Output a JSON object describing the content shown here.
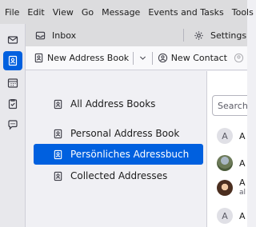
{
  "menubar": {
    "items": [
      "File",
      "Edit",
      "View",
      "Go",
      "Message",
      "Events and Tasks",
      "Tools"
    ]
  },
  "tabs": {
    "inbox": "Inbox",
    "settings": "Settings"
  },
  "toolbar": {
    "new_address_book": "New Address Book",
    "new_contact": "New Contact"
  },
  "books": {
    "items": [
      {
        "label": "All Address Books",
        "selected": false
      },
      {
        "label": "Personal Address Book",
        "selected": false
      },
      {
        "label": "Persönliches Adressbuch",
        "selected": true
      },
      {
        "label": "Collected Addresses",
        "selected": false
      }
    ]
  },
  "contacts": {
    "search_placeholder": "Search",
    "items": [
      {
        "initial": "A",
        "name": "A",
        "sub": ""
      },
      {
        "initial": "",
        "name": "A",
        "sub": ""
      },
      {
        "initial": "",
        "name": "A",
        "sub": "al"
      },
      {
        "initial": "A",
        "name": "A",
        "sub": ""
      }
    ]
  },
  "colors": {
    "accent": "#0060df",
    "menubar_bg": "#dcdcde"
  }
}
